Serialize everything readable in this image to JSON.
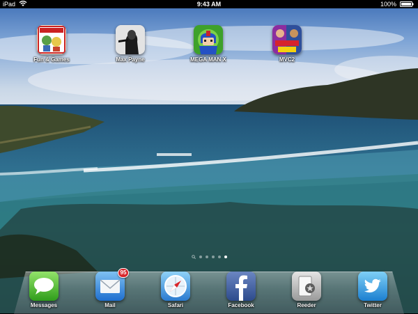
{
  "status_bar": {
    "device_name": "iPad",
    "time": "9:43 AM",
    "battery_percent": "100%",
    "battery_level": 1.0
  },
  "home_apps": [
    {
      "label": "Fun & Games",
      "icon": "fun-and-games-folder-icon"
    },
    {
      "label": "Max Payne",
      "icon": "max-payne-icon"
    },
    {
      "label": "MEGA MAN X",
      "icon": "mega-man-x-icon"
    },
    {
      "label": "MVC2",
      "icon": "mvc2-icon"
    }
  ],
  "page_indicator": {
    "pages": 5,
    "current_page": 5,
    "has_spotlight": true
  },
  "dock_apps": [
    {
      "label": "Messages",
      "icon": "messages-icon"
    },
    {
      "label": "Mail",
      "icon": "mail-icon",
      "badge": "95"
    },
    {
      "label": "Safari",
      "icon": "safari-icon"
    },
    {
      "label": "Facebook",
      "icon": "facebook-icon"
    },
    {
      "label": "Reeder",
      "icon": "reeder-icon"
    },
    {
      "label": "Twitter",
      "icon": "twitter-icon"
    }
  ],
  "colors": {
    "status_bar": "#000000",
    "badge": "#d8262b",
    "sky": "#5f8ccb",
    "sea": "#2b6a86"
  }
}
